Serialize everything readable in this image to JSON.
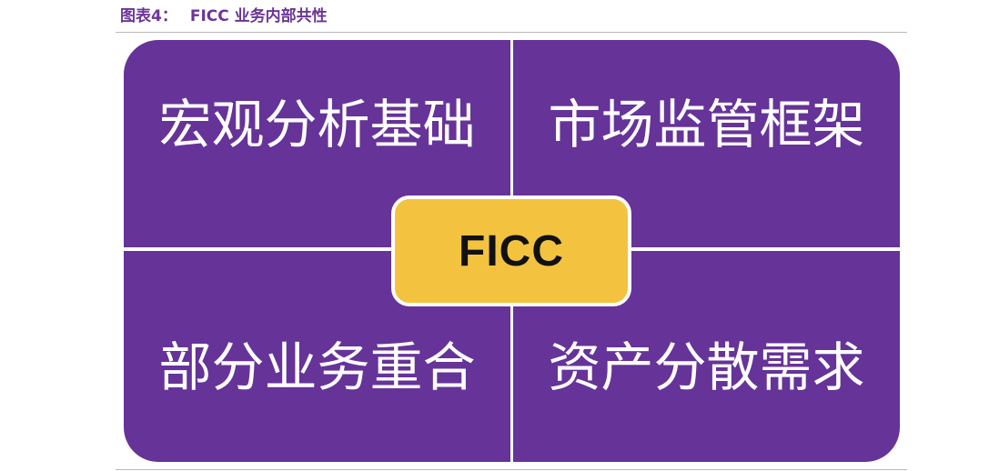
{
  "caption": {
    "prefix": "图表4：",
    "title": "FICC 业务内部共性"
  },
  "diagram": {
    "center": "FICC",
    "quadrants": [
      {
        "label": "宏观分析基础"
      },
      {
        "label": "市场监管框架"
      },
      {
        "label": "部分业务重合"
      },
      {
        "label": "资产分散需求"
      }
    ]
  },
  "colors": {
    "quadrant_fill": "#663399",
    "center_fill": "#f3c340",
    "caption_text": "#6b3597"
  }
}
